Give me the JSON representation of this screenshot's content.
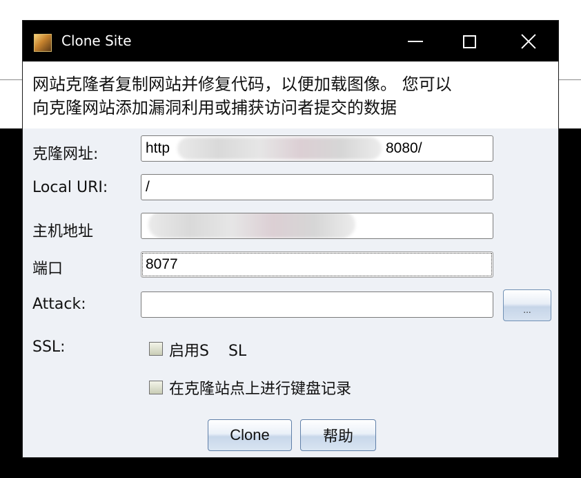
{
  "window": {
    "title": "Clone Site",
    "icon": "app-icon"
  },
  "description": {
    "line1": "网站克隆者复制网站并修复代码，以便加载图像。 您可以",
    "line2": "向克隆网站添加漏洞利用或捕获访问者提交的数据"
  },
  "form": {
    "clone_url": {
      "label": "克隆网址:",
      "value_start": "http",
      "value_end": "8080/"
    },
    "local_uri": {
      "label": "Local URI:",
      "value": "/"
    },
    "host": {
      "label": "主机地址",
      "value": ""
    },
    "port": {
      "label": "端口",
      "value": "8077"
    },
    "attack": {
      "label": "Attack:",
      "value": "",
      "browse_label": "..."
    },
    "ssl": {
      "label": "SSL:",
      "checkbox_label": "启用S    SL",
      "checked": false
    },
    "keylog": {
      "checkbox_label": "在克隆站点上进行键盘记录",
      "checked": false
    }
  },
  "buttons": {
    "clone": "Clone",
    "help": "帮助"
  },
  "colors": {
    "titlebar": "#000000",
    "dialog_bg": "#eef1f6",
    "button_border": "#5f7fa8"
  }
}
